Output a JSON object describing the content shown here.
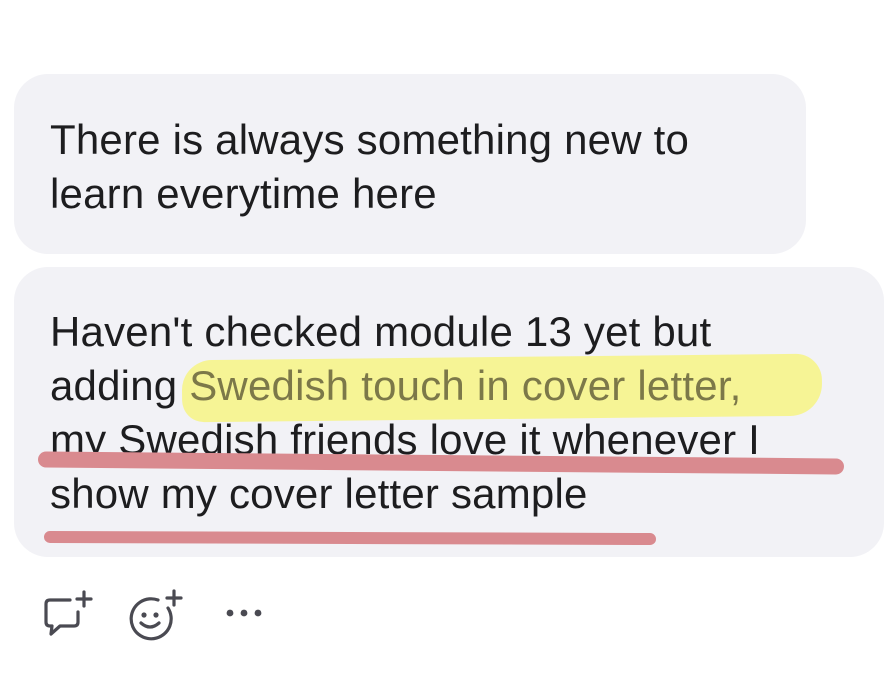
{
  "messages": [
    {
      "lines": [
        "There is always something new to",
        "learn everytime here"
      ]
    },
    {
      "line1": "Haven't checked module 13 yet but",
      "line2_prefix": "adding ",
      "line2_highlight": "Swedish touch in cover letter,",
      "line3": "my Swedish friends love it whenever I",
      "line4": "show my cover letter sample"
    }
  ],
  "annotations": {
    "highlight_color": "#f6f38f",
    "underline_color": "#d98a8f"
  },
  "actions": [
    {
      "icon": "add-comment-icon"
    },
    {
      "icon": "add-reaction-icon"
    },
    {
      "icon": "more-options-icon"
    }
  ],
  "colors": {
    "bubble_background": "#f2f2f6",
    "text": "#1d1d1f",
    "icon": "#4a4a52"
  }
}
